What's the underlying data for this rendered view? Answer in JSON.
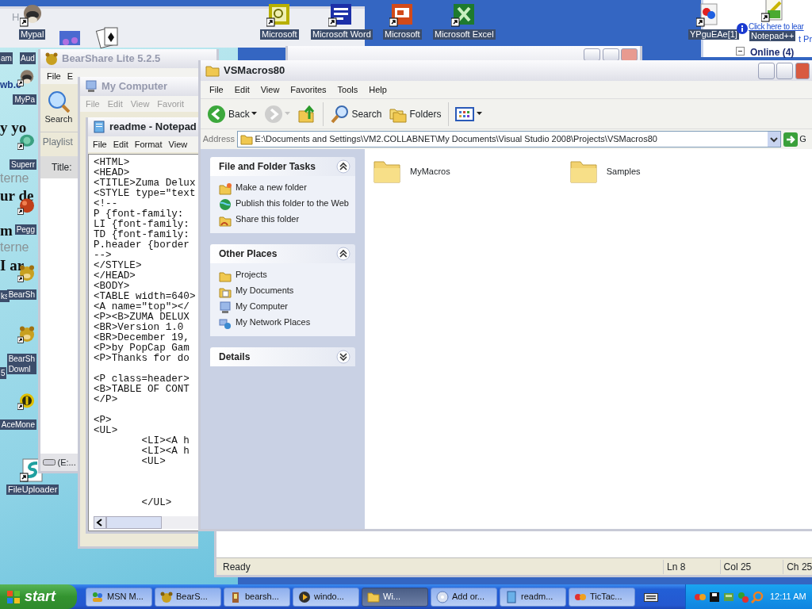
{
  "desktop": {
    "icons": [
      {
        "label": "Mypal",
        "kind": "raccoon"
      },
      {
        "label": "Microsoft",
        "kind": "outlook"
      },
      {
        "label": "Microsoft Word",
        "kind": "word"
      },
      {
        "label": "Microsoft",
        "kind": "powerpoint"
      },
      {
        "label": "Microsoft Excel",
        "kind": "excel"
      },
      {
        "label": "YPguEAe[1]",
        "kind": "image"
      },
      {
        "label": "Notepad++",
        "kind": "notepad"
      },
      {
        "label": "MyPa",
        "kind": "raccoon"
      },
      {
        "label": "Superr",
        "kind": "turtle"
      },
      {
        "label": "Pegg",
        "kind": "ball"
      },
      {
        "label": "BearSh",
        "kind": "bear"
      },
      {
        "label": "BearSh\nDownl",
        "kind": "bear"
      },
      {
        "label": "AceMone",
        "kind": "money"
      },
      {
        "label": "FileUploader",
        "kind": "uploader"
      },
      {
        "kind": "music"
      },
      {
        "kind": "cards"
      }
    ],
    "fragments": [
      {
        "text": "H",
        "kind": "faded"
      },
      {
        "text": "am",
        "kind": "label"
      },
      {
        "text": "Aud",
        "kind": "label"
      },
      {
        "text": "wb.c",
        "kind": "bold"
      },
      {
        "text": "y yo",
        "kind": "heading"
      },
      {
        "text": "terne",
        "kind": "faded-big"
      },
      {
        "text": "ur de",
        "kind": "heading"
      },
      {
        "text": "m",
        "kind": "heading"
      },
      {
        "text": "terne",
        "kind": "faded-big"
      },
      {
        "text": "I ar",
        "kind": "heading"
      },
      {
        "text": "ks",
        "kind": "label"
      },
      {
        "text": "5",
        "kind": "label"
      }
    ]
  },
  "msn_panel": {
    "link": "Click here to lear",
    "link_tail": "t Pr",
    "group": "Online (4)",
    "expanded": true
  },
  "bearshare_window": {
    "title": "BearShare Lite 5.2.5",
    "menu": [
      "File",
      "E"
    ],
    "search_label": "Search",
    "tab": "Playlist",
    "column": "Title:",
    "drive": "(E:..."
  },
  "my_computer_window": {
    "title": "My Computer",
    "menu": [
      "File",
      "Edit",
      "View",
      "Favorit"
    ]
  },
  "notepad_window": {
    "title": "readme - Notepad",
    "menu": [
      "File",
      "Edit",
      "Format",
      "View"
    ],
    "lines": [
      {
        "kind": "code",
        "text": "<HTML>"
      },
      {
        "kind": "code",
        "text": "<HEAD>"
      },
      {
        "kind": "code",
        "text": "<TITLE>Zuma Delux"
      },
      {
        "kind": "code",
        "text": "<STYLE type=\"text"
      },
      {
        "kind": "code",
        "text": "<!--"
      },
      {
        "kind": "code",
        "text": "P {font-family:"
      },
      {
        "kind": "code",
        "text": "LI {font-family:"
      },
      {
        "kind": "code",
        "text": "TD {font-family:"
      },
      {
        "kind": "code",
        "text": "P.header {border"
      },
      {
        "kind": "code",
        "text": "-->"
      },
      {
        "kind": "code",
        "text": "</STYLE>"
      },
      {
        "kind": "code",
        "text": "</HEAD>"
      },
      {
        "kind": "code",
        "text": "<BODY>"
      },
      {
        "kind": "code",
        "text": "<TABLE width=640>"
      },
      {
        "kind": "code",
        "text": "<A name=\"top\"></"
      },
      {
        "kind": "code",
        "text": "<P><B>ZUMA DELUX"
      },
      {
        "kind": "code",
        "text": "<BR>Version 1.0"
      },
      {
        "kind": "code",
        "text": "<BR>December 19,"
      },
      {
        "kind": "code",
        "text": "<P>by PopCap Gam"
      },
      {
        "kind": "code",
        "text": "<P>Thanks for do"
      },
      {
        "kind": "blank"
      },
      {
        "kind": "code",
        "text": "<P class=header>"
      },
      {
        "kind": "code",
        "text": "<B>TABLE OF CONT"
      },
      {
        "kind": "code",
        "text": "</P>"
      },
      {
        "kind": "blank"
      },
      {
        "kind": "code",
        "text": "<P>"
      },
      {
        "kind": "code",
        "text": "<UL>"
      },
      {
        "kind": "code",
        "text": "\t<LI><A h"
      },
      {
        "kind": "code",
        "text": "\t<LI><A h"
      },
      {
        "kind": "code",
        "text": "\t<UL>"
      },
      {
        "kind": "blank"
      },
      {
        "kind": "blank"
      },
      {
        "kind": "blank"
      },
      {
        "kind": "code",
        "text": "\t</UL>"
      }
    ]
  },
  "status_window": {
    "status": "Ready",
    "line": "Ln 8",
    "col": "Col 25",
    "ch": "Ch 25"
  },
  "explorer_window": {
    "title": "VSMacros80",
    "menu": [
      "File",
      "Edit",
      "View",
      "Favorites",
      "Tools",
      "Help"
    ],
    "toolbar": [
      {
        "kind": "back",
        "label": "Back",
        "disabled": false
      },
      {
        "kind": "forward",
        "disabled": true
      },
      {
        "kind": "up"
      },
      {
        "kind": "search",
        "label": "Search"
      },
      {
        "kind": "folders",
        "label": "Folders"
      },
      {
        "kind": "views"
      }
    ],
    "address_label": "Address",
    "address": "E:\\Documents and Settings\\VM2.COLLABNET\\My Documents\\Visual Studio 2008\\Projects\\VSMacros80",
    "go": "G",
    "panels": [
      {
        "title": "File and Folder Tasks",
        "expanded": true,
        "items": [
          {
            "label": "Make a new folder",
            "kind": "new-folder"
          },
          {
            "label": "Publish this folder to the Web",
            "kind": "globe"
          },
          {
            "label": "Share this folder",
            "kind": "share"
          }
        ]
      },
      {
        "title": "Other Places",
        "expanded": true,
        "items": [
          {
            "label": "Projects",
            "kind": "folder"
          },
          {
            "label": "My Documents",
            "kind": "documents"
          },
          {
            "label": "My Computer",
            "kind": "computer"
          },
          {
            "label": "My Network Places",
            "kind": "network"
          }
        ]
      },
      {
        "title": "Details",
        "expanded": false
      }
    ],
    "files": [
      {
        "name": "MyMacros"
      },
      {
        "name": "Samples"
      }
    ]
  },
  "taskbar": {
    "start": "start",
    "tasks": [
      {
        "label": "MSN M...",
        "kind": "msn",
        "selected": false
      },
      {
        "label": "BearS...",
        "kind": "bear",
        "selected": false
      },
      {
        "label": "bearsh...",
        "kind": "install",
        "selected": false
      },
      {
        "label": "windo...",
        "kind": "media",
        "selected": false
      },
      {
        "label": "Wi...",
        "kind": "folder",
        "selected": true
      },
      {
        "label": "Add or...",
        "kind": "cd",
        "selected": false
      },
      {
        "label": "readm...",
        "kind": "notepad",
        "selected": false
      },
      {
        "label": "TicTac...",
        "kind": "game",
        "selected": false
      }
    ],
    "clock": "12:11 AM"
  }
}
